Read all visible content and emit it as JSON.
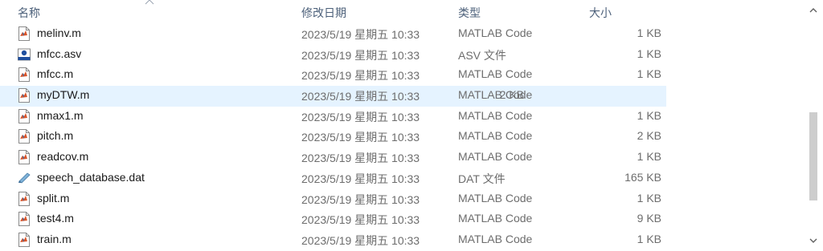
{
  "columns": {
    "name": "名称",
    "date": "修改日期",
    "type": "类型",
    "size": "大小"
  },
  "files": [
    {
      "name": "melinv.m",
      "date": "2023/5/19 星期五 10:33",
      "type": "MATLAB Code",
      "size": "1 KB",
      "icon": "matlab-file-icon"
    },
    {
      "name": "mfcc.asv",
      "date": "2023/5/19 星期五 10:33",
      "type": "ASV 文件",
      "size": "1 KB",
      "icon": "asv-file-icon"
    },
    {
      "name": "mfcc.m",
      "date": "2023/5/19 星期五 10:33",
      "type": "MATLAB Code",
      "size": "1 KB",
      "icon": "matlab-file-icon"
    },
    {
      "name": "myDTW.m",
      "date": "2023/5/19 星期五 10:33",
      "type": "MATLAB Code",
      "size": "2 KB",
      "icon": "matlab-file-icon"
    },
    {
      "name": "nmax1.m",
      "date": "2023/5/19 星期五 10:33",
      "type": "MATLAB Code",
      "size": "1 KB",
      "icon": "matlab-file-icon"
    },
    {
      "name": "pitch.m",
      "date": "2023/5/19 星期五 10:33",
      "type": "MATLAB Code",
      "size": "2 KB",
      "icon": "matlab-file-icon"
    },
    {
      "name": "readcov.m",
      "date": "2023/5/19 星期五 10:33",
      "type": "MATLAB Code",
      "size": "1 KB",
      "icon": "matlab-file-icon"
    },
    {
      "name": "speech_database.dat",
      "date": "2023/5/19 星期五 10:33",
      "type": "DAT 文件",
      "size": "165 KB",
      "icon": "dat-file-icon"
    },
    {
      "name": "split.m",
      "date": "2023/5/19 星期五 10:33",
      "type": "MATLAB Code",
      "size": "1 KB",
      "icon": "matlab-file-icon"
    },
    {
      "name": "test4.m",
      "date": "2023/5/19 星期五 10:33",
      "type": "MATLAB Code",
      "size": "9 KB",
      "icon": "matlab-file-icon"
    },
    {
      "name": "train.m",
      "date": "2023/5/19 星期五 10:33",
      "type": "MATLAB Code",
      "size": "1 KB",
      "icon": "matlab-file-icon"
    }
  ],
  "hovered_row": "myDTW.m",
  "colors": {
    "header_text": "#4c607a",
    "hover_bg": "#e5f3ff",
    "secondary_text": "#6d6d6d"
  }
}
